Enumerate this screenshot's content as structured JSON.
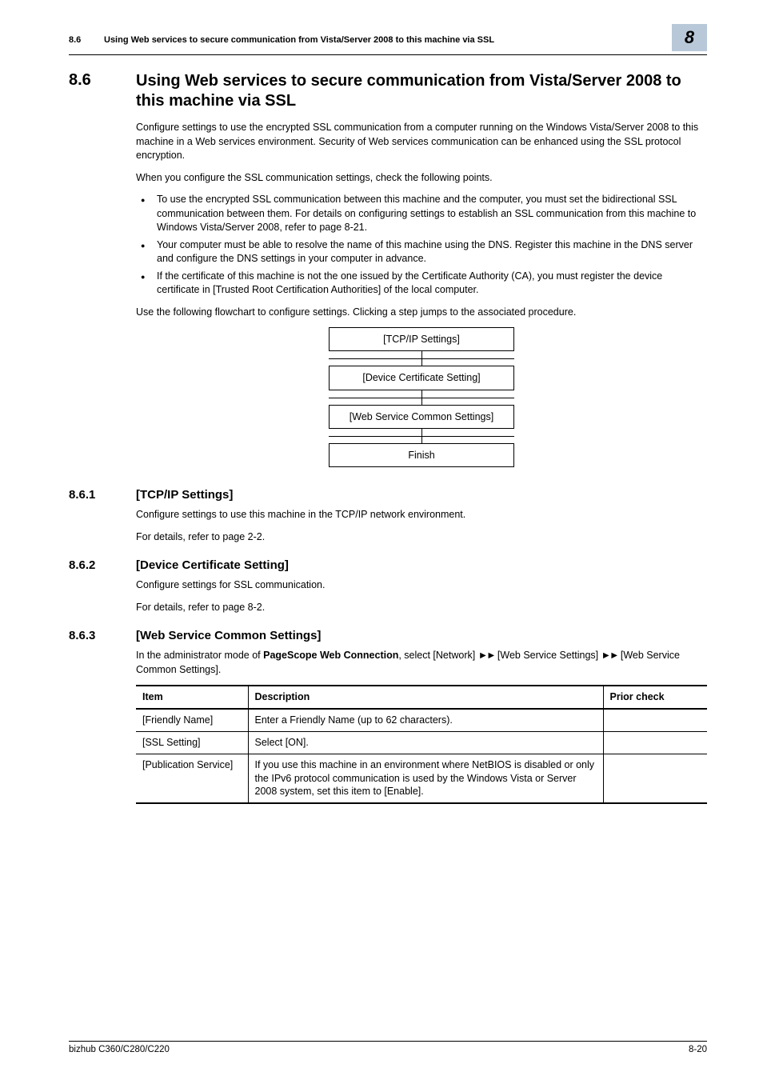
{
  "header": {
    "section_num": "8.6",
    "section_title": "Using Web services to secure communication from Vista/Server 2008 to this machine via SSL",
    "chapter": "8"
  },
  "h1": {
    "num": "8.6",
    "title": "Using Web services to secure communication from Vista/Server 2008 to this machine via SSL"
  },
  "intro": {
    "p1": "Configure settings to use the encrypted SSL communication from a computer running on the Windows Vista/Server 2008 to this machine in a Web services environment. Security of Web services communication can be enhanced using the SSL protocol encryption.",
    "p2": "When you configure the SSL communication settings, check the following points.",
    "b1": "To use the encrypted SSL communication between this machine and the computer, you must set the bidirectional SSL communication between them. For details on configuring settings to establish an SSL communication from this machine to Windows Vista/Server 2008, refer to page 8-21.",
    "b2": "Your computer must be able to resolve the name of this machine using the DNS. Register this machine in the DNS server and configure the DNS settings in your computer in advance.",
    "b3": "If the certificate of this machine is not the one issued by the Certificate Authority (CA), you must register the device certificate in [Trusted Root Certification Authorities] of the local computer.",
    "p3": "Use the following flowchart to configure settings. Clicking a step jumps to the associated procedure."
  },
  "flow": {
    "s1": "[TCP/IP Settings]",
    "s2": "[Device Certificate Setting]",
    "s3": "[Web Service Common Settings]",
    "s4": "Finish"
  },
  "sec1": {
    "num": "8.6.1",
    "title": "[TCP/IP Settings]",
    "p1": "Configure settings to use this machine in the TCP/IP network environment.",
    "p2": "For details, refer to page 2-2."
  },
  "sec2": {
    "num": "8.6.2",
    "title": "[Device Certificate Setting]",
    "p1": "Configure settings for SSL communication.",
    "p2": "For details, refer to page 8-2."
  },
  "sec3": {
    "num": "8.6.3",
    "title": "[Web Service Common Settings]",
    "p1_pre": "In the administrator mode of ",
    "p1_bold": "PageScope Web Connection",
    "p1_post1": ", select [Network] ",
    "p1_post2": " [Web Service Settings] ",
    "p1_post3": " [Web Service Common Settings].",
    "arrows": "►►",
    "table": {
      "h_item": "Item",
      "h_desc": "Description",
      "h_prior": "Prior check",
      "rows": [
        {
          "item": "[Friendly Name]",
          "desc": "Enter a Friendly Name (up to 62 characters).",
          "prior": ""
        },
        {
          "item": "[SSL Setting]",
          "desc": "Select [ON].",
          "prior": ""
        },
        {
          "item": "[Publication Service]",
          "desc": "If you use this machine in an environment where NetBIOS is disabled or only the IPv6 protocol communication is used by the Windows Vista or Server 2008 system, set this item to [Enable].",
          "prior": ""
        }
      ]
    }
  },
  "footer": {
    "left": "bizhub C360/C280/C220",
    "right": "8-20"
  }
}
